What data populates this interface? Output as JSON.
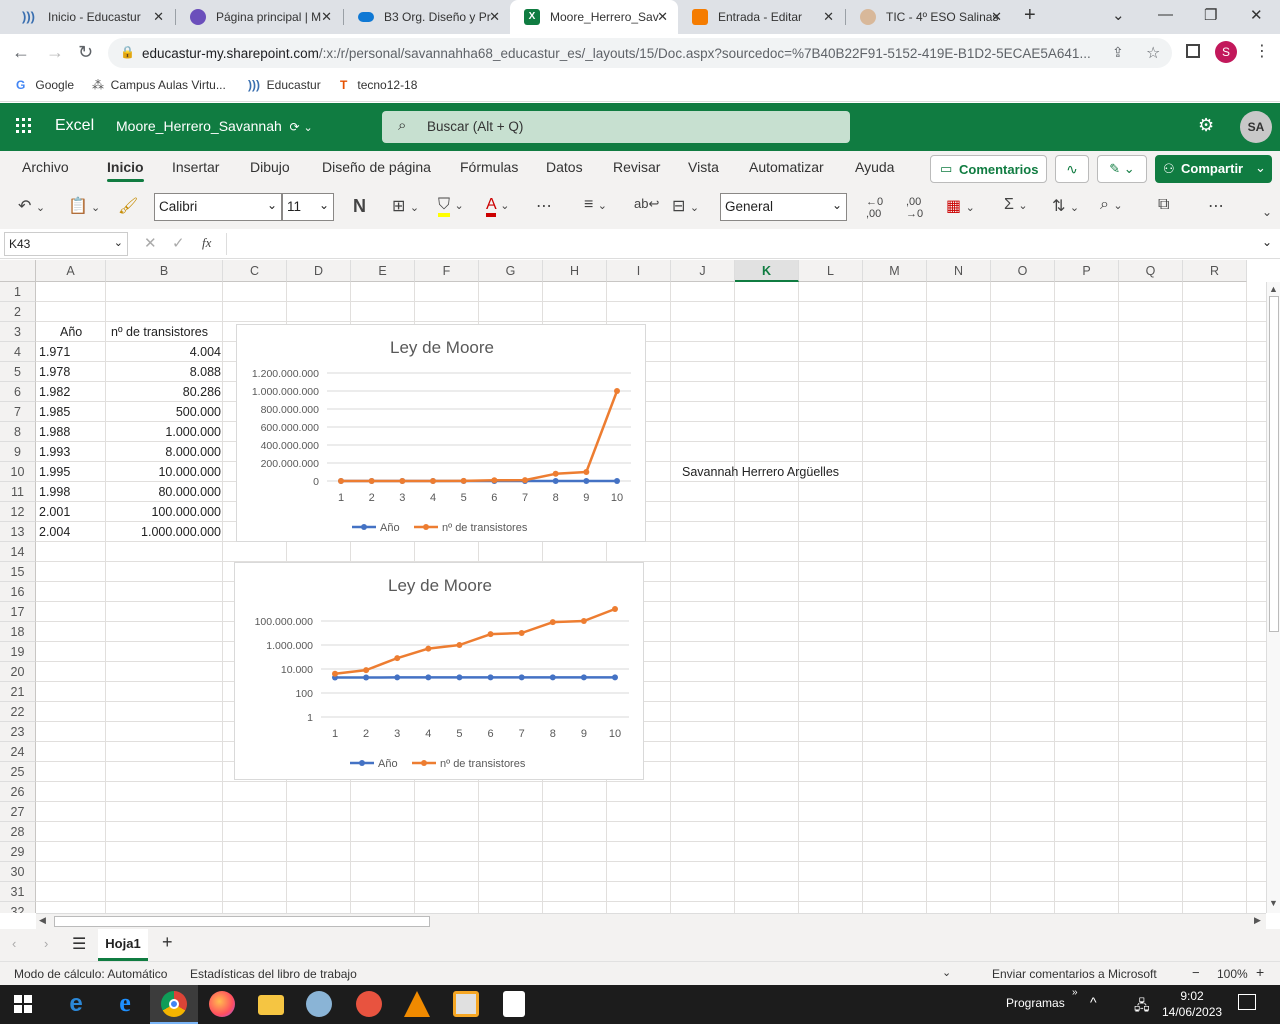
{
  "browser": {
    "tabs": [
      {
        "label": "Inicio - Educastur",
        "color": "#3a6fb0"
      },
      {
        "label": "Página principal | M",
        "color": "#6b4fbb"
      },
      {
        "label": "B3 Org. Diseño y Pr",
        "color": "#0f78d4"
      },
      {
        "label": "Moore_Herrero_Sav",
        "color": "#107c41"
      },
      {
        "label": "Entrada - Editar",
        "color": "#f57c00"
      },
      {
        "label": "TIC - 4º ESO Salinas",
        "color": "#a0785a"
      }
    ],
    "url_host": "educastur-my.sharepoint.com",
    "url_path": "/:x:/r/personal/savannahha68_educastur_es/_layouts/15/Doc.aspx?sourcedoc=%7B40B22F91-5152-419E-B1D2-5ECAE5A641...",
    "profile_letter": "S",
    "bookmarks": [
      "Google",
      "Campus Aulas Virtu...",
      "Educastur",
      "tecno12-18"
    ]
  },
  "excel": {
    "app_name": "Excel",
    "doc_name": "Moore_Herrero_Savannah",
    "search_placeholder": "Buscar (Alt + Q)",
    "user_initials": "SA",
    "ribbon_tabs": [
      "Archivo",
      "Inicio",
      "Insertar",
      "Dibujo",
      "Diseño de página",
      "Fórmulas",
      "Datos",
      "Revisar",
      "Vista",
      "Automatizar",
      "Ayuda"
    ],
    "comments_label": "Comentarios",
    "share_label": "Compartir",
    "font_name": "Calibri",
    "font_size": "11",
    "bold_label": "N",
    "number_format": "General",
    "name_box": "K43",
    "fx_label": "fx"
  },
  "sheet": {
    "columns": [
      "A",
      "B",
      "C",
      "D",
      "E",
      "F",
      "G",
      "H",
      "I",
      "J",
      "K",
      "L",
      "M",
      "N",
      "O",
      "P",
      "Q",
      "R"
    ],
    "selected_column": "K",
    "rows": [
      "1",
      "2",
      "3",
      "4",
      "5",
      "6",
      "7",
      "8",
      "9",
      "10",
      "11",
      "12",
      "13",
      "14",
      "15",
      "16",
      "17",
      "18",
      "19",
      "20",
      "21",
      "22",
      "23",
      "24",
      "25",
      "26",
      "27",
      "28",
      "29",
      "30",
      "31",
      "32"
    ],
    "header_a": "Año",
    "header_b": "nº de transistores",
    "years": [
      "1.971",
      "1.978",
      "1.982",
      "1.985",
      "1.988",
      "1.993",
      "1.995",
      "1.998",
      "2.001",
      "2.004"
    ],
    "transistors": [
      "4.004",
      "8.088",
      "80.286",
      "500.000",
      "1.000.000",
      "8.000.000",
      "10.000.000",
      "80.000.000",
      "100.000.000",
      "1.000.000.000"
    ],
    "author_cell": "Savannah Herrero Argüelles",
    "sheet_tab": "Hoja1"
  },
  "chart_data": [
    {
      "type": "line",
      "title": "Ley de Moore",
      "categories": [
        "1",
        "2",
        "3",
        "4",
        "5",
        "6",
        "7",
        "8",
        "9",
        "10"
      ],
      "series": [
        {
          "name": "Año",
          "values": [
            1971,
            1978,
            1982,
            1985,
            1988,
            1993,
            1995,
            1998,
            2001,
            2004
          ],
          "color": "#4472c4"
        },
        {
          "name": "nº de transistores",
          "values": [
            4004,
            8088,
            80286,
            500000,
            1000000,
            8000000,
            10000000,
            80000000,
            100000000,
            1000000000
          ],
          "color": "#ed7d31"
        }
      ],
      "ylim": [
        0,
        1200000000
      ],
      "yticks": [
        "0",
        "200.000.000",
        "400.000.000",
        "600.000.000",
        "800.000.000",
        "1.000.000.000",
        "1.200.000.000"
      ],
      "legend": "bottom",
      "grid": true,
      "log": false
    },
    {
      "type": "line",
      "title": "Ley de Moore",
      "categories": [
        "1",
        "2",
        "3",
        "4",
        "5",
        "6",
        "7",
        "8",
        "9",
        "10"
      ],
      "series": [
        {
          "name": "Año",
          "values": [
            1971,
            1978,
            1982,
            1985,
            1988,
            1993,
            1995,
            1998,
            2001,
            2004
          ],
          "color": "#4472c4"
        },
        {
          "name": "nº de transistores",
          "values": [
            4004,
            8088,
            80286,
            500000,
            1000000,
            8000000,
            10000000,
            80000000,
            100000000,
            1000000000
          ],
          "color": "#ed7d31"
        }
      ],
      "yticks": [
        "1",
        "100",
        "10.000",
        "1.000.000",
        "100.000.000"
      ],
      "legend": "bottom",
      "grid": true,
      "log": true
    }
  ],
  "status": {
    "calc_mode": "Modo de cálculo: Automático",
    "stats": "Estadísticas del libro de trabajo",
    "feedback": "Enviar comentarios a Microsoft",
    "zoom": "100%"
  },
  "taskbar": {
    "programs_label": "Programas",
    "time": "9:02",
    "date": "14/06/2023"
  }
}
